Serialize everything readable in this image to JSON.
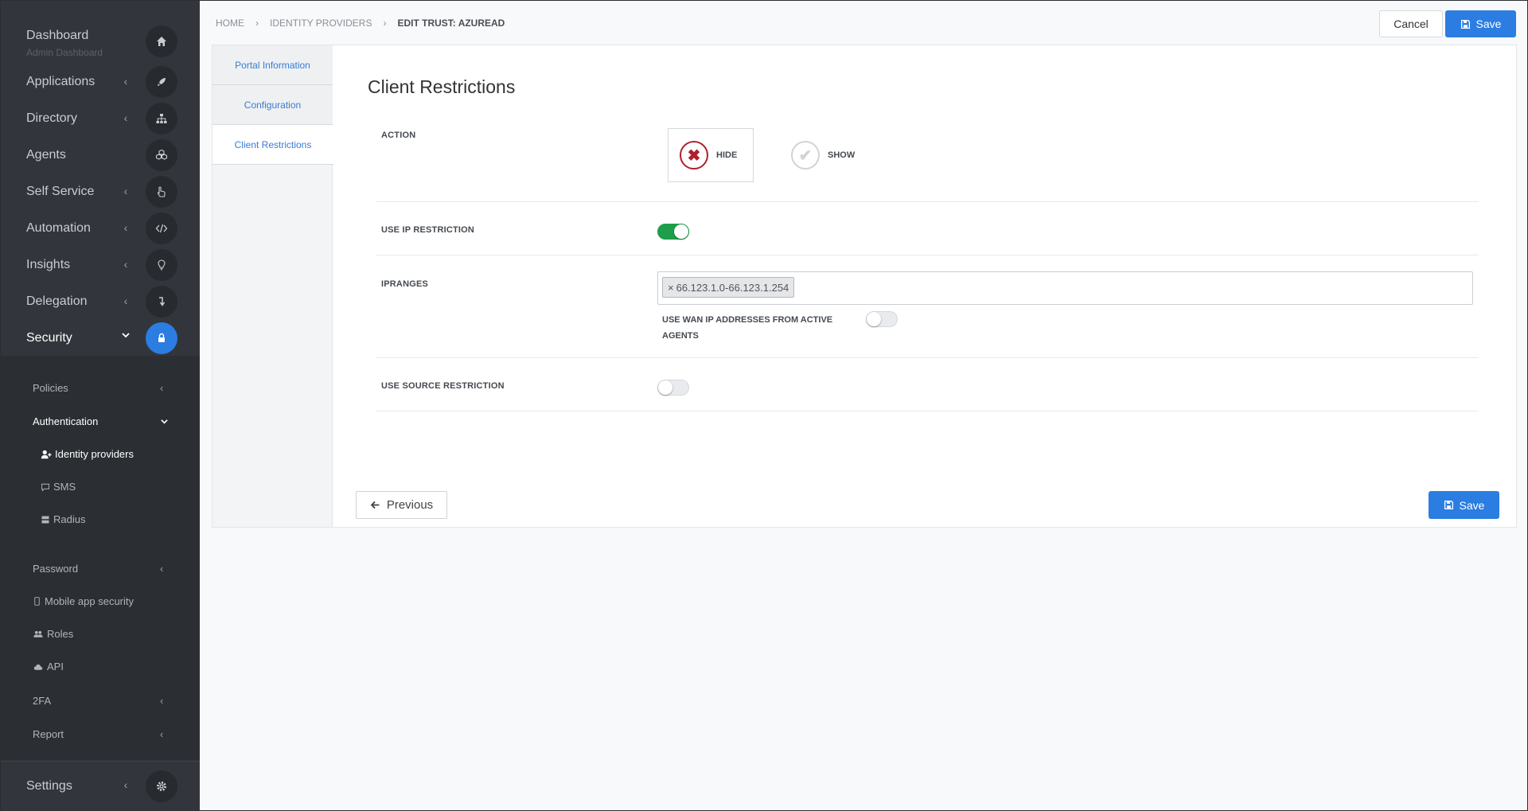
{
  "sidebar": {
    "dashboard": {
      "label": "Dashboard",
      "sub": "Admin Dashboard",
      "icon": "home-icon"
    },
    "items": [
      {
        "label": "Applications",
        "icon": "rocket-icon"
      },
      {
        "label": "Directory",
        "icon": "sitemap-icon"
      },
      {
        "label": "Agents",
        "icon": "cubes-icon"
      },
      {
        "label": "Self Service",
        "icon": "hand-pointer-icon"
      },
      {
        "label": "Automation",
        "icon": "code-icon"
      },
      {
        "label": "Insights",
        "icon": "lightbulb-icon"
      },
      {
        "label": "Delegation",
        "icon": "level-down-icon"
      },
      {
        "label": "Security",
        "icon": "lock-icon"
      }
    ],
    "security_sub": {
      "policies": "Policies",
      "authentication": "Authentication",
      "identity_providers": "Identity providers",
      "sms": "SMS",
      "radius": "Radius",
      "password": "Password",
      "mobile_app_security": "Mobile app security",
      "roles": "Roles",
      "api": "API",
      "twofa": "2FA",
      "report": "Report"
    },
    "settings": {
      "label": "Settings",
      "icon": "gear-icon"
    }
  },
  "breadcrumb": {
    "home": "HOME",
    "identity_providers": "IDENTITY PROVIDERS",
    "current": "EDIT TRUST: AZUREAD"
  },
  "header": {
    "cancel_label": "Cancel",
    "save_label": "Save"
  },
  "tabs": [
    "Portal Information",
    "Configuration",
    "Client Restrictions"
  ],
  "content": {
    "title": "Client Restrictions",
    "action_label": "ACTION",
    "hide_label": "HIDE",
    "show_label": "SHOW",
    "ip_restriction_label": "USE IP RESTRICTION",
    "ip_restriction_on": true,
    "ipranges_label": "IPRANGES",
    "iprange_tag": "66.123.1.0-66.123.1.254",
    "wan_label": "USE WAN IP ADDRESSES FROM ACTIVE AGENTS",
    "wan_on": false,
    "source_restriction_label": "USE SOURCE RESTRICTION",
    "source_restriction_on": false
  },
  "footer": {
    "previous_label": "Previous",
    "save_label": "Save"
  },
  "colors": {
    "accent": "#2b7de2",
    "danger": "#b0202a",
    "toggle_on": "#1e9e4a",
    "sidebar": "#32363c"
  }
}
